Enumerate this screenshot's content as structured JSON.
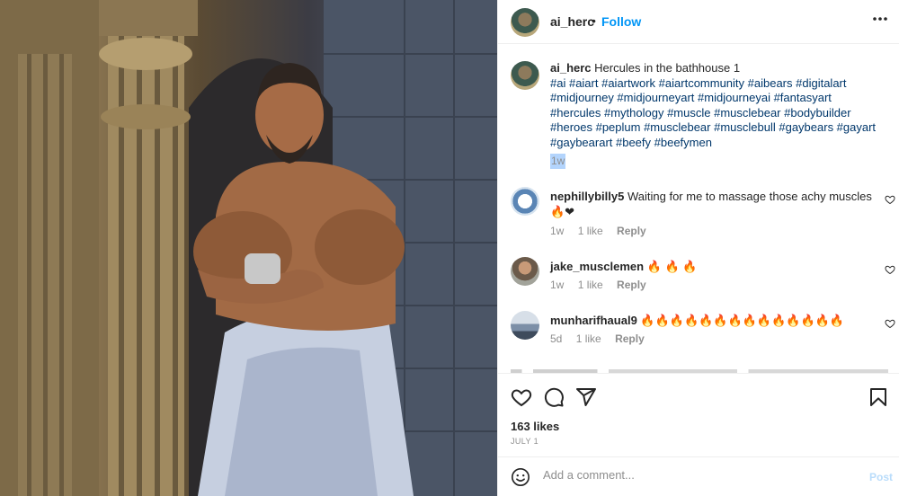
{
  "post": {
    "image": {
      "description": "Hercules muscular man leaning on stone column wearing white towel"
    },
    "header": {
      "username": "ai_herc",
      "separator": "•",
      "follow_label": "Follow",
      "more_icon": "more-horizontal-icon"
    },
    "caption": {
      "username": "ai_herc",
      "text": "Hercules in the bathhouse 1",
      "hashtags_line1": "#ai #aiart #aiartwork #aiartcommunity #aibears #digitalart",
      "hashtags_line2": "#midjourney #midjourneyart #midjourneyai #fantasyart",
      "hashtags_line3": "#hercules #mythology #muscle #musclebear #bodybuilder",
      "hashtags_line4": "#heroes #peplum #musclebear #musclebull #gaybears #gayart",
      "hashtags_line5": "#gaybearart #beefy #beefymen",
      "timestamp": "1w"
    },
    "comments": [
      {
        "username": "nephillybilly5",
        "text": "Waiting for me to massage those achy muscles",
        "emoji": "🔥❤",
        "time": "1w",
        "likes": "1 like",
        "reply": "Reply"
      },
      {
        "username": "jake_musclemen",
        "text": "",
        "emoji": "🔥 🔥 🔥",
        "time": "1w",
        "likes": "1 like",
        "reply": "Reply"
      },
      {
        "username": "munharifhaual9",
        "text": "",
        "emoji": "🔥🔥🔥🔥🔥🔥🔥🔥🔥🔥🔥🔥🔥🔥",
        "time": "5d",
        "likes": "1 like",
        "reply": "Reply"
      }
    ],
    "actions": {
      "like_icon": "heart-icon",
      "comment_icon": "comment-icon",
      "share_icon": "share-icon",
      "save_icon": "bookmark-icon",
      "likes": "163 likes",
      "date": "JULY 1"
    },
    "add_comment": {
      "emoji_icon": "emoji-icon",
      "placeholder": "Add a comment...",
      "post_label": "Post"
    },
    "colors": {
      "accent": "#0095f6",
      "text": "#262626",
      "muted": "#8e8e8e",
      "hashtag": "#00376b"
    }
  }
}
